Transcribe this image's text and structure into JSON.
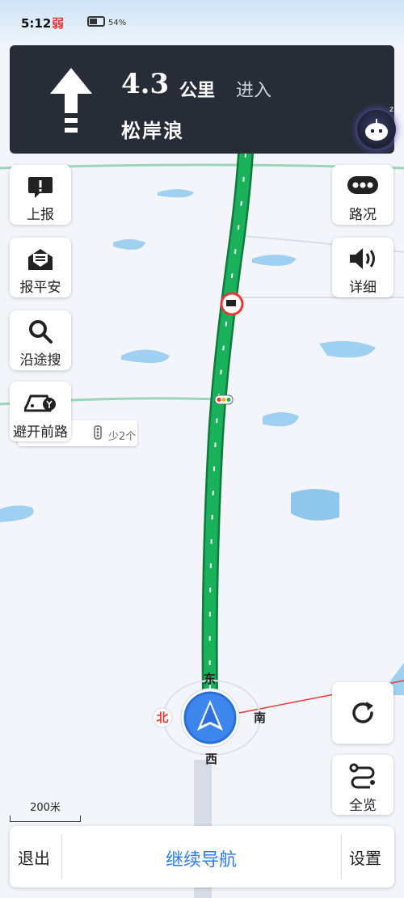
{
  "status_bar": {
    "time": "5:12",
    "signal": "弱",
    "battery": "54%"
  },
  "guidance": {
    "distance": "4.3",
    "unit": "公里",
    "action": "进入",
    "road": "松岸浪"
  },
  "left_buttons": [
    {
      "label": "上报",
      "icon": "report-icon"
    },
    {
      "label": "报平安",
      "icon": "mail-icon"
    },
    {
      "label": "沿途搜",
      "icon": "search-icon"
    },
    {
      "label": "避开前路",
      "icon": "car-avoid-icon"
    }
  ],
  "right_buttons": [
    {
      "label": "路况",
      "icon": "traffic-icon"
    },
    {
      "label": "详细",
      "icon": "speaker-icon"
    }
  ],
  "route_bubble": {
    "text": "少2个"
  },
  "compass": {
    "north": "北",
    "east": "东",
    "south": "南",
    "west": "西"
  },
  "right_lower_buttons": [
    {
      "label": "",
      "icon": "refresh-icon"
    },
    {
      "label": "全览",
      "icon": "overview-icon"
    }
  ],
  "scale": "200米",
  "bottom_bar": {
    "exit": "退出",
    "continue": "继续导航",
    "settings": "设置"
  },
  "colors": {
    "route": "#19b25a",
    "guide_panel": "#262d36",
    "accent": "#2f7be8",
    "north": "#e53935"
  }
}
